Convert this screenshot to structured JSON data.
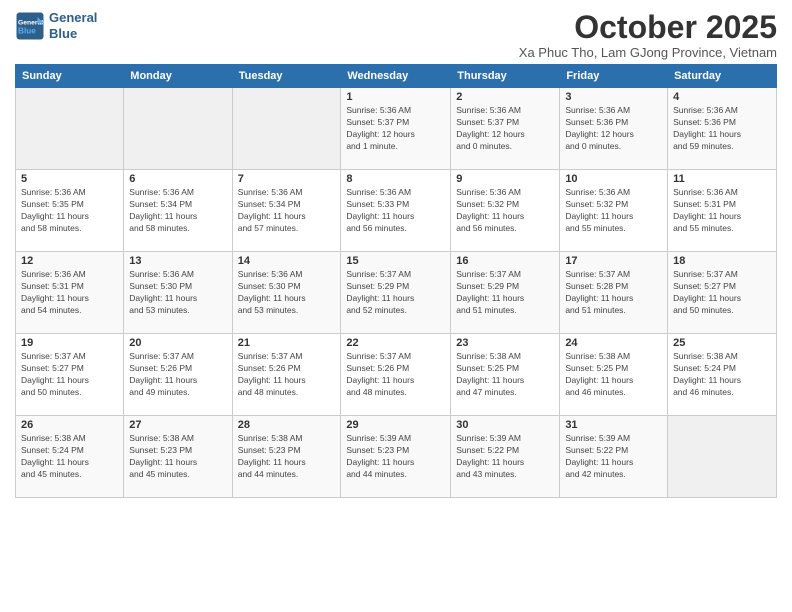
{
  "logo": {
    "line1": "General",
    "line2": "Blue"
  },
  "title": "October 2025",
  "subtitle": "Xa Phuc Tho, Lam GJong Province, Vietnam",
  "weekdays": [
    "Sunday",
    "Monday",
    "Tuesday",
    "Wednesday",
    "Thursday",
    "Friday",
    "Saturday"
  ],
  "weeks": [
    [
      {
        "day": "",
        "info": ""
      },
      {
        "day": "",
        "info": ""
      },
      {
        "day": "",
        "info": ""
      },
      {
        "day": "1",
        "info": "Sunrise: 5:36 AM\nSunset: 5:37 PM\nDaylight: 12 hours\nand 1 minute."
      },
      {
        "day": "2",
        "info": "Sunrise: 5:36 AM\nSunset: 5:37 PM\nDaylight: 12 hours\nand 0 minutes."
      },
      {
        "day": "3",
        "info": "Sunrise: 5:36 AM\nSunset: 5:36 PM\nDaylight: 12 hours\nand 0 minutes."
      },
      {
        "day": "4",
        "info": "Sunrise: 5:36 AM\nSunset: 5:36 PM\nDaylight: 11 hours\nand 59 minutes."
      }
    ],
    [
      {
        "day": "5",
        "info": "Sunrise: 5:36 AM\nSunset: 5:35 PM\nDaylight: 11 hours\nand 58 minutes."
      },
      {
        "day": "6",
        "info": "Sunrise: 5:36 AM\nSunset: 5:34 PM\nDaylight: 11 hours\nand 58 minutes."
      },
      {
        "day": "7",
        "info": "Sunrise: 5:36 AM\nSunset: 5:34 PM\nDaylight: 11 hours\nand 57 minutes."
      },
      {
        "day": "8",
        "info": "Sunrise: 5:36 AM\nSunset: 5:33 PM\nDaylight: 11 hours\nand 56 minutes."
      },
      {
        "day": "9",
        "info": "Sunrise: 5:36 AM\nSunset: 5:32 PM\nDaylight: 11 hours\nand 56 minutes."
      },
      {
        "day": "10",
        "info": "Sunrise: 5:36 AM\nSunset: 5:32 PM\nDaylight: 11 hours\nand 55 minutes."
      },
      {
        "day": "11",
        "info": "Sunrise: 5:36 AM\nSunset: 5:31 PM\nDaylight: 11 hours\nand 55 minutes."
      }
    ],
    [
      {
        "day": "12",
        "info": "Sunrise: 5:36 AM\nSunset: 5:31 PM\nDaylight: 11 hours\nand 54 minutes."
      },
      {
        "day": "13",
        "info": "Sunrise: 5:36 AM\nSunset: 5:30 PM\nDaylight: 11 hours\nand 53 minutes."
      },
      {
        "day": "14",
        "info": "Sunrise: 5:36 AM\nSunset: 5:30 PM\nDaylight: 11 hours\nand 53 minutes."
      },
      {
        "day": "15",
        "info": "Sunrise: 5:37 AM\nSunset: 5:29 PM\nDaylight: 11 hours\nand 52 minutes."
      },
      {
        "day": "16",
        "info": "Sunrise: 5:37 AM\nSunset: 5:29 PM\nDaylight: 11 hours\nand 51 minutes."
      },
      {
        "day": "17",
        "info": "Sunrise: 5:37 AM\nSunset: 5:28 PM\nDaylight: 11 hours\nand 51 minutes."
      },
      {
        "day": "18",
        "info": "Sunrise: 5:37 AM\nSunset: 5:27 PM\nDaylight: 11 hours\nand 50 minutes."
      }
    ],
    [
      {
        "day": "19",
        "info": "Sunrise: 5:37 AM\nSunset: 5:27 PM\nDaylight: 11 hours\nand 50 minutes."
      },
      {
        "day": "20",
        "info": "Sunrise: 5:37 AM\nSunset: 5:26 PM\nDaylight: 11 hours\nand 49 minutes."
      },
      {
        "day": "21",
        "info": "Sunrise: 5:37 AM\nSunset: 5:26 PM\nDaylight: 11 hours\nand 48 minutes."
      },
      {
        "day": "22",
        "info": "Sunrise: 5:37 AM\nSunset: 5:26 PM\nDaylight: 11 hours\nand 48 minutes."
      },
      {
        "day": "23",
        "info": "Sunrise: 5:38 AM\nSunset: 5:25 PM\nDaylight: 11 hours\nand 47 minutes."
      },
      {
        "day": "24",
        "info": "Sunrise: 5:38 AM\nSunset: 5:25 PM\nDaylight: 11 hours\nand 46 minutes."
      },
      {
        "day": "25",
        "info": "Sunrise: 5:38 AM\nSunset: 5:24 PM\nDaylight: 11 hours\nand 46 minutes."
      }
    ],
    [
      {
        "day": "26",
        "info": "Sunrise: 5:38 AM\nSunset: 5:24 PM\nDaylight: 11 hours\nand 45 minutes."
      },
      {
        "day": "27",
        "info": "Sunrise: 5:38 AM\nSunset: 5:23 PM\nDaylight: 11 hours\nand 45 minutes."
      },
      {
        "day": "28",
        "info": "Sunrise: 5:38 AM\nSunset: 5:23 PM\nDaylight: 11 hours\nand 44 minutes."
      },
      {
        "day": "29",
        "info": "Sunrise: 5:39 AM\nSunset: 5:23 PM\nDaylight: 11 hours\nand 44 minutes."
      },
      {
        "day": "30",
        "info": "Sunrise: 5:39 AM\nSunset: 5:22 PM\nDaylight: 11 hours\nand 43 minutes."
      },
      {
        "day": "31",
        "info": "Sunrise: 5:39 AM\nSunset: 5:22 PM\nDaylight: 11 hours\nand 42 minutes."
      },
      {
        "day": "",
        "info": ""
      }
    ]
  ]
}
